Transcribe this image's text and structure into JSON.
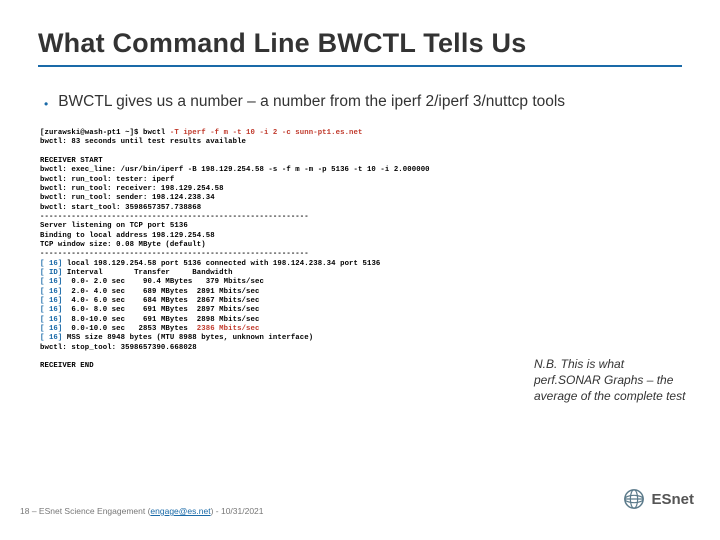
{
  "title": "What Command Line BWCTL Tells Us",
  "bullet": "BWCTL gives us a number – a number from the iperf 2/iperf 3/nuttcp tools",
  "term": {
    "l01a": "[zurawski@wash-pt1 ~]$ bwctl ",
    "l01b": "-T iperf -f m -t 10 -i 2 -c sunn-pt1.es.net",
    "l02": "bwctl: 83 seconds until test results available",
    "l03": "",
    "l04": "RECEIVER START",
    "l05": "bwctl: exec_line: /usr/bin/iperf -B 198.129.254.58 -s -f m -m -p 5136 -t 10 -i 2.000000",
    "l06": "bwctl: run_tool: tester: iperf",
    "l07": "bwctl: run_tool: receiver: 198.129.254.58",
    "l08": "bwctl: run_tool: sender: 198.124.238.34",
    "l09": "bwctl: start_tool: 3598657357.738868",
    "l10": "------------------------------------------------------------",
    "l11": "Server listening on TCP port 5136",
    "l12": "Binding to local address 198.129.254.58",
    "l13": "TCP window size: 0.08 MByte (default)",
    "l14": "------------------------------------------------------------",
    "l15a": "[ 16]",
    "l15b": " local 198.129.254.58 port 5136 connected with 198.124.238.34 port 5136",
    "l16a": "[ ID]",
    "l16b": " Interval       Transfer     Bandwidth",
    "l17a": "[ 16]",
    "l17b": "  0.0- 2.0 sec    90.4 MBytes   379 Mbits/sec",
    "l18a": "[ 16]",
    "l18b": "  2.0- 4.0 sec    689 MBytes  2891 Mbits/sec",
    "l19a": "[ 16]",
    "l19b": "  4.0- 6.0 sec    684 MBytes  2867 Mbits/sec",
    "l20a": "[ 16]",
    "l20b": "  6.0- 8.0 sec    691 MBytes  2897 Mbits/sec",
    "l21a": "[ 16]",
    "l21b": "  8.0-10.0 sec    691 MBytes  2898 Mbits/sec",
    "l22a": "[ 16]",
    "l22b": "  0.0-10.0 sec   2853 MBytes  ",
    "l22c": "2386 Mbits/sec",
    "l23a": "[ 16]",
    "l23b": " MSS size 8948 bytes (MTU 8988 bytes, unknown interface)",
    "l24": "bwctl: stop_tool: 3598657390.668028",
    "l25": "",
    "l26": "RECEIVER END"
  },
  "note": "N.B. This is what perf.SONAR Graphs – the average of the complete test",
  "logo_text": "ESnet",
  "footer_prefix": "18 – ESnet Science Engagement (",
  "footer_link": "engage@es.net",
  "footer_suffix": ") - 10/31/2021"
}
